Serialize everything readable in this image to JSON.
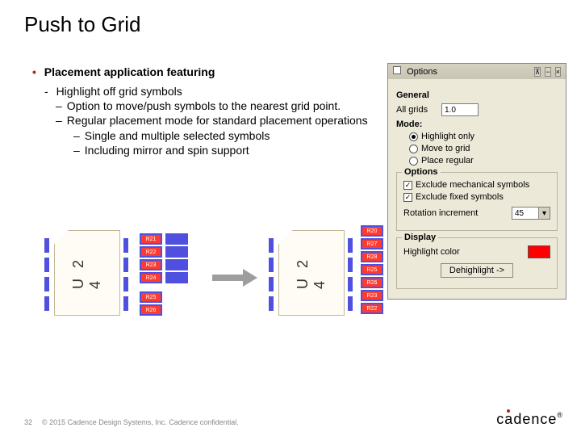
{
  "title": "Push to Grid",
  "bullet": "Placement application featuring",
  "subs": [
    {
      "indent": 0,
      "marker": "-",
      "text": "Highlight off grid symbols"
    },
    {
      "indent": 1,
      "marker": "–",
      "text": "Option to  move/push symbols to the nearest grid point."
    },
    {
      "indent": 1,
      "marker": "–",
      "text": "Regular placement mode for standard placement operations"
    },
    {
      "indent": 2,
      "marker": "–",
      "text": "Single and multiple selected symbols"
    },
    {
      "indent": 2,
      "marker": "–",
      "text": "Including mirror and spin support"
    }
  ],
  "diagram": {
    "chip_label": "U 2 4",
    "left_res": [
      "R21",
      "R22",
      "R23",
      "R24",
      "R25",
      "R26"
    ],
    "right_res": [
      "R20",
      "R27",
      "R28",
      "R25",
      "R26",
      "R23",
      "R22"
    ]
  },
  "dialog": {
    "title": "Options",
    "general": {
      "label": "General",
      "allgrids_label": "All grids",
      "allgrids_value": "1.0",
      "mode_label": "Mode:",
      "modes": [
        "Highlight only",
        "Move to grid",
        "Place regular"
      ],
      "selected_mode": 0
    },
    "options": {
      "legend": "Options",
      "exclude_mech": "Exclude mechanical symbols",
      "exclude_fixed": "Exclude fixed symbols",
      "rotation_label": "Rotation increment",
      "rotation_value": "45"
    },
    "display": {
      "legend": "Display",
      "highlight_label": "Highlight color",
      "highlight_color": "#ff0000",
      "dehighlight": "Dehighlight ->"
    }
  },
  "footer": {
    "page": "32",
    "copyright": "© 2015 Cadence Design Systems, Inc. Cadence confidential."
  },
  "logo": "cādence"
}
